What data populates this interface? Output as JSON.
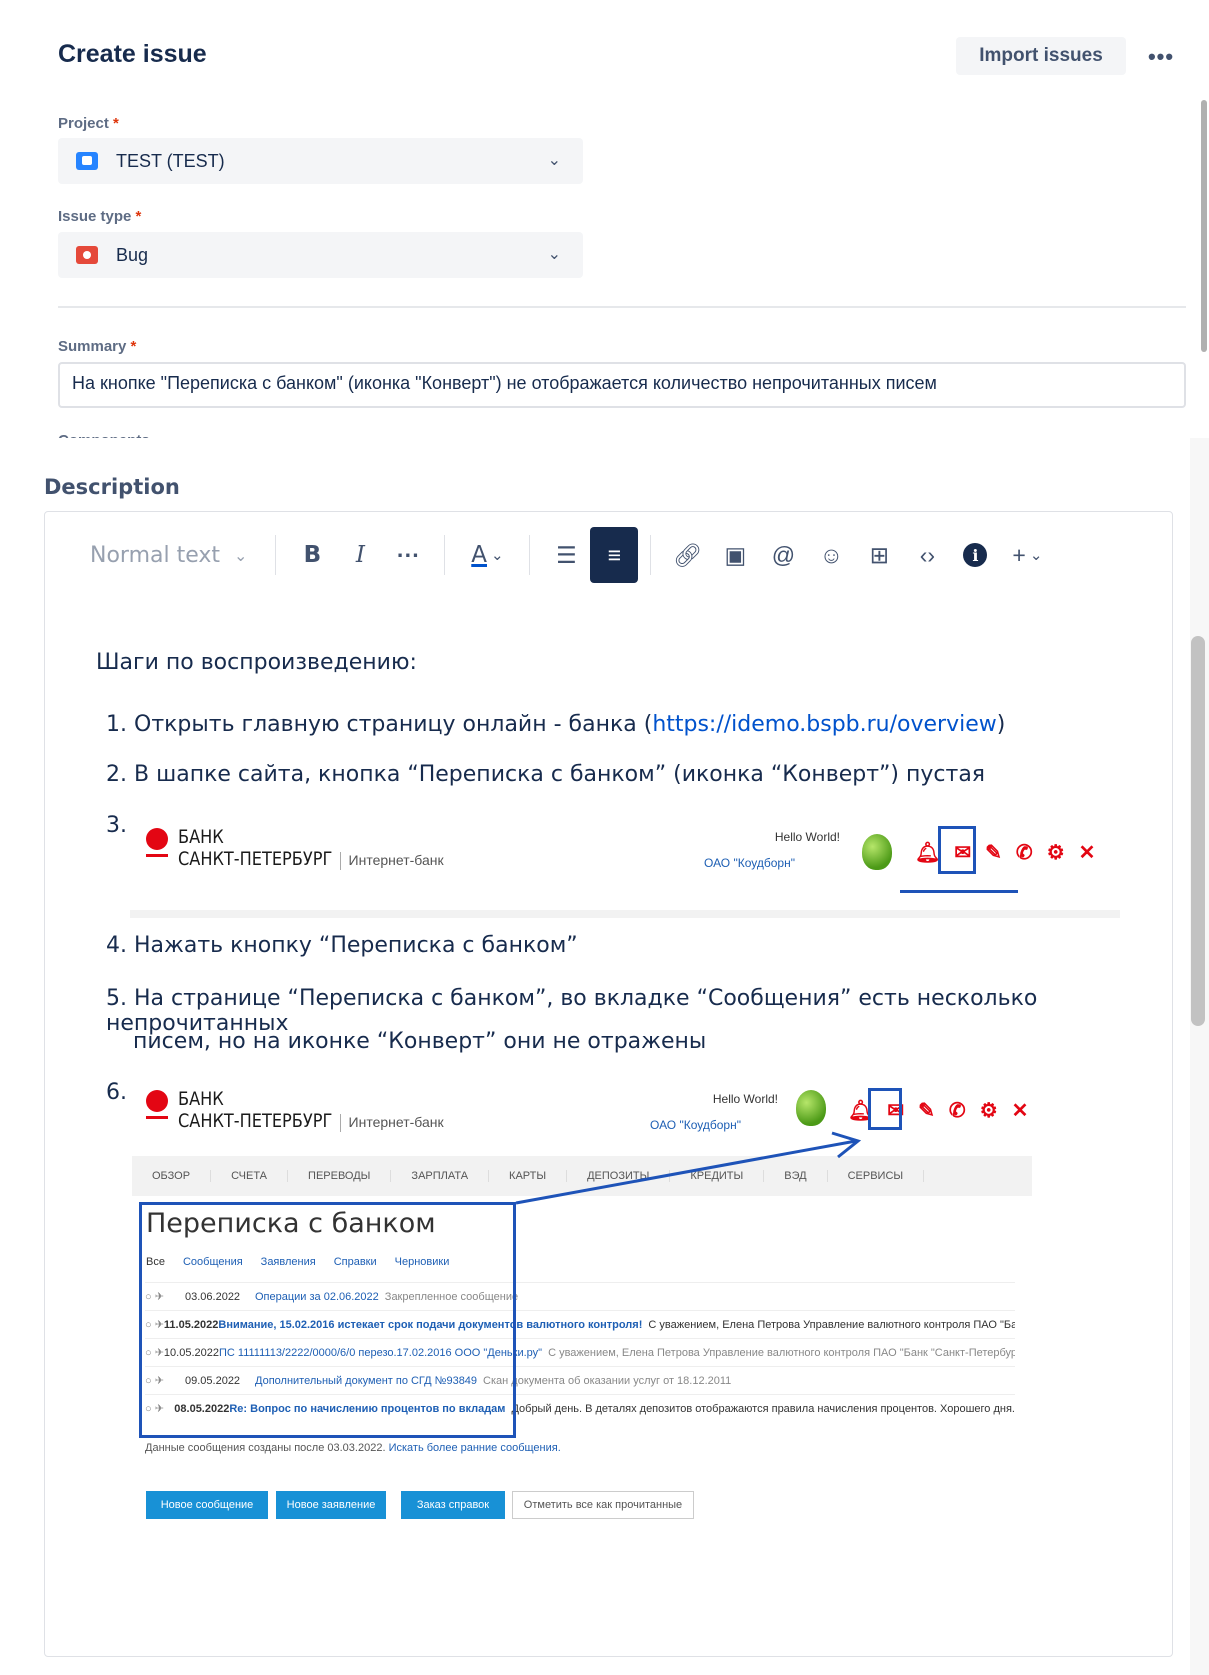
{
  "header": {
    "title": "Create issue",
    "import_label": "Import issues",
    "more_label": "•••"
  },
  "project": {
    "label": "Project",
    "required": "*",
    "value": "TEST (TEST)"
  },
  "issue_type": {
    "label": "Issue type",
    "required": "*",
    "value": "Bug"
  },
  "summary": {
    "label": "Summary",
    "required": "*",
    "value": "На кнопке \"Переписка с банком\" (иконка \"Конверт\") не отображается количество непрочитанных писем"
  },
  "components": {
    "label": "Components"
  },
  "description": {
    "label": "Description",
    "toolbar": {
      "text_style": "Normal text",
      "bold": "B",
      "italic": "I",
      "more": "···",
      "color": "A"
    },
    "heading": "Шаги по воспроизведению:",
    "steps": [
      {
        "num": "1.",
        "text": "Открыть главную страницу онлайн - банка (",
        "link": "https://idemo.bspb.ru/overview",
        "after": ")"
      },
      {
        "num": "2.",
        "text": "В шапке сайта, кнопка “Переписка с банком” (иконка “Конверт”) пустая"
      },
      {
        "num": "3."
      },
      {
        "num": "4.",
        "text": "Нажать кнопку “Переписка с банком”"
      },
      {
        "num": "5.",
        "text": "На странице “Переписка с банком”, во вкладке “Сообщения” есть несколько непрочитанных",
        "text2": "писем, но на иконке “Конверт” они не отражены"
      },
      {
        "num": "6."
      }
    ]
  },
  "screenshot": {
    "bank_name_1": "БАНК",
    "bank_name_2": "САНКТ-ПЕТЕРБУРГ",
    "bank_sub": "Интернет-банк",
    "hello": "Hello World!",
    "company": "ОАО \"Коудборн\"",
    "nav": [
      "ОБЗОР",
      "СЧЕТА",
      "ПЕРЕВОДЫ",
      "ЗАРПЛАТА",
      "КАРТЫ",
      "ДЕПОЗИТЫ",
      "КРЕДИТЫ",
      "ВЭД",
      "СЕРВИСЫ"
    ],
    "page_title": "Переписка с банком",
    "tabs": [
      "Все",
      "Сообщения",
      "Заявления",
      "Справки",
      "Черновики"
    ],
    "rows": [
      {
        "date": "03.06.2022",
        "text": "Операции за 02.06.2022",
        "extra": "Закрепленное сообщение"
      },
      {
        "date": "11.05.2022",
        "text": "Внимание, 15.02.2016 истекает срок подачи документов валютного контроля!",
        "extra": "С уважением, Елена Петрова Управление валютного контроля ПАО \"Банк"
      },
      {
        "date": "10.05.2022",
        "text": "ПС 11111113/2222/0000/6/0 перезо.17.02.2016 ООО \"Деньки.ру\"",
        "extra": "С уважением, Елена Петрова Управление валютного контроля ПАО \"Банк \"Санкт-Петербург\" тел:"
      },
      {
        "date": "09.05.2022",
        "text": "Дополнительный документ по СГД №93849",
        "extra": "Скан документа об оказании услуг от 18.12.2011"
      },
      {
        "date": "08.05.2022",
        "text": "Re: Вопрос по начислению процентов по вкладам",
        "extra": "Добрый день. В деталях депозитов отображаются правила начисления процентов. Хорошего дня."
      }
    ],
    "footnote": "Данные сообщения созданы после 03.03.2022.",
    "footnote_link": "Искать более ранние сообщения.",
    "buttons": [
      "Новое сообщение",
      "Новое заявление",
      "Заказ справок",
      "Отметить все как прочитанные"
    ]
  }
}
